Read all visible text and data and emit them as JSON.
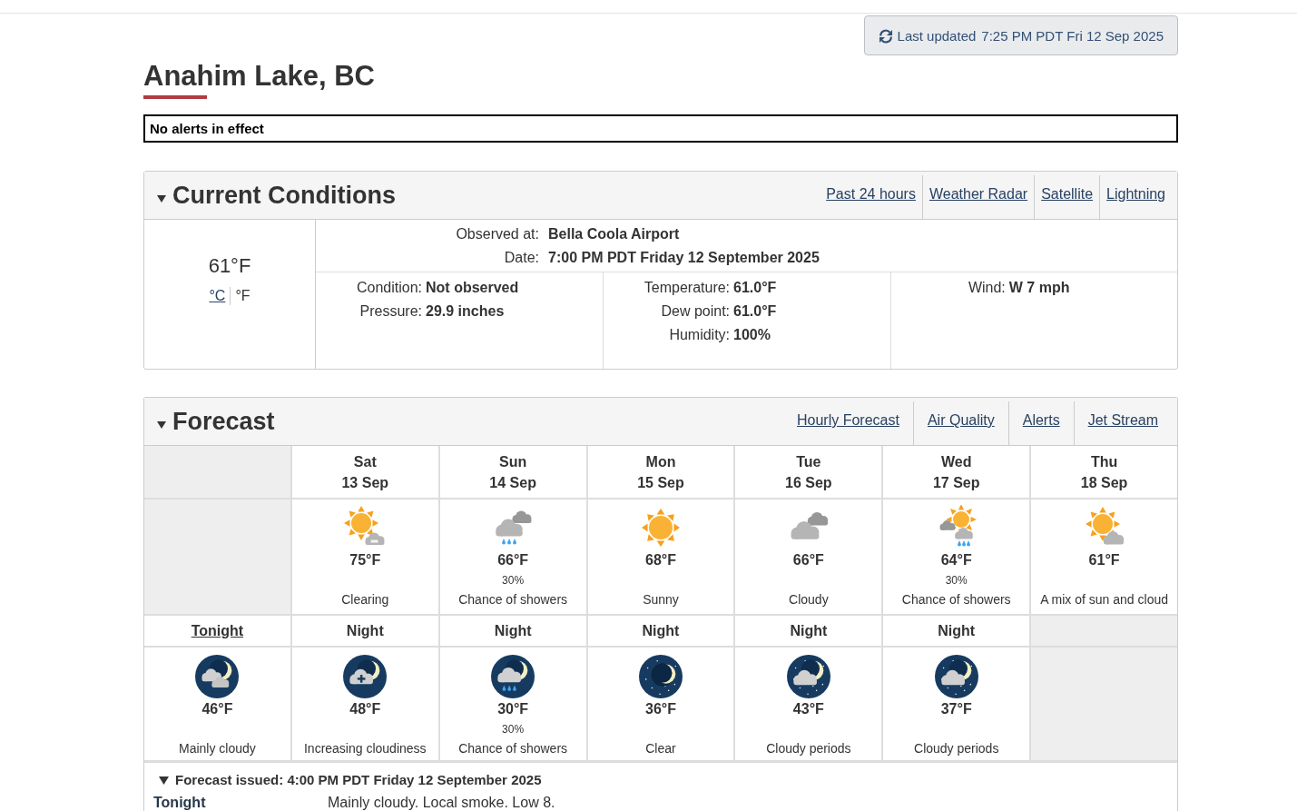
{
  "last_updated": {
    "label": "Last updated",
    "time": "7:25 PM PDT Fri 12 Sep 2025"
  },
  "location": "Anahim Lake, BC",
  "alerts": "No alerts in effect",
  "current_conditions": {
    "title": "Current Conditions",
    "expanded": true,
    "links": [
      "Past 24 hours",
      "Weather Radar",
      "Satellite",
      "Lightning"
    ],
    "temperature": "61°F",
    "units": [
      {
        "label": "°C",
        "selected": false
      },
      {
        "label": "°F",
        "selected": true
      }
    ],
    "station": [
      {
        "label": "Observed at:",
        "value": "Bella Coola Airport"
      },
      {
        "label": "Date:",
        "value": "7:00 PM PDT Friday 12 September 2025"
      }
    ],
    "observations": [
      {
        "fields": [
          {
            "label": "Condition:",
            "value": "Not observed"
          },
          {
            "label": "Pressure:",
            "value": "29.9 inches"
          }
        ]
      },
      {
        "fields": [
          {
            "label": "Temperature:",
            "value": "61.0°F"
          },
          {
            "label": "Dew point:",
            "value": "61.0°F"
          },
          {
            "label": "Humidity:",
            "value": "100%"
          }
        ]
      },
      {
        "fields": [
          {
            "label": "Wind:",
            "value": "W 7 mph"
          }
        ]
      }
    ]
  },
  "forecast": {
    "title": "Forecast",
    "expanded": true,
    "links": [
      "Hourly Forecast",
      "Air Quality",
      "Alerts",
      "Jet Stream"
    ],
    "days": [
      {
        "day": "Sat",
        "date": "13 Sep",
        "kind": "clearing",
        "temp": "75°F",
        "summary": "Clearing"
      },
      {
        "day": "Sun",
        "date": "14 Sep",
        "kind": "showers",
        "temp": "66°F",
        "pop": "30%",
        "summary": "Chance of showers"
      },
      {
        "day": "Mon",
        "date": "15 Sep",
        "kind": "sunny",
        "temp": "68°F",
        "summary": "Sunny"
      },
      {
        "day": "Tue",
        "date": "16 Sep",
        "kind": "cloudy",
        "temp": "66°F",
        "summary": "Cloudy"
      },
      {
        "day": "Wed",
        "date": "17 Sep",
        "kind": "sunshowers",
        "temp": "64°F",
        "pop": "30%",
        "summary": "Chance of showers"
      },
      {
        "day": "Thu",
        "date": "18 Sep",
        "kind": "mix",
        "temp": "61°F",
        "summary": "A mix of sun and cloud"
      }
    ],
    "nights": [
      {
        "label": "Tonight",
        "link": true,
        "kind": "mainlycloudy",
        "temp": "46°F",
        "summary": "Mainly cloudy"
      },
      {
        "label": "Night",
        "link": false,
        "kind": "increasing",
        "temp": "48°F",
        "summary": "Increasing cloudiness"
      },
      {
        "label": "Night",
        "link": false,
        "kind": "showers",
        "temp": "30°F",
        "pop": "30%",
        "summary": "Chance of showers"
      },
      {
        "label": "Night",
        "link": false,
        "kind": "clear",
        "temp": "36°F",
        "summary": "Clear"
      },
      {
        "label": "Night",
        "link": false,
        "kind": "periods",
        "temp": "43°F",
        "summary": "Cloudy periods"
      },
      {
        "label": "Night",
        "link": false,
        "kind": "periods",
        "temp": "37°F",
        "summary": "Cloudy periods"
      }
    ],
    "details": {
      "expanded": true,
      "issued": "Forecast issued: 4:00 PM PDT Friday 12 September 2025",
      "periods": [
        {
          "name": "Tonight",
          "text": "Mainly cloudy. Local smoke. Low 8."
        }
      ]
    }
  }
}
